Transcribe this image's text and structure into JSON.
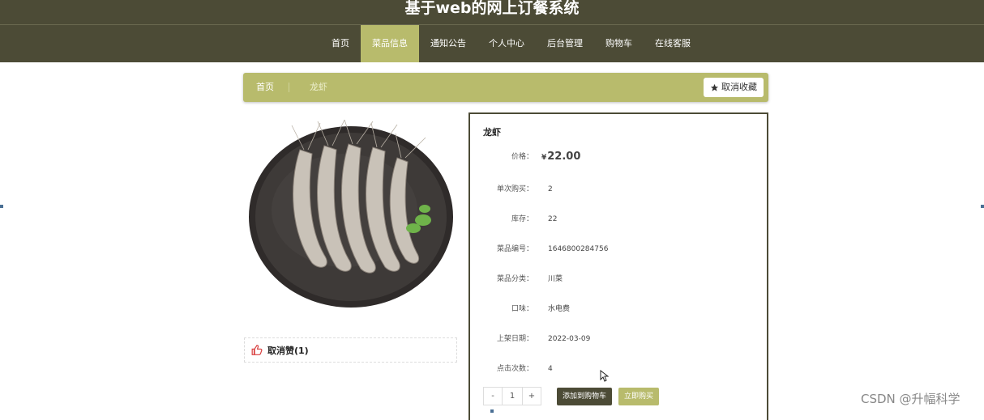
{
  "header": {
    "title": "基于web的网上订餐系统"
  },
  "nav": {
    "items": [
      {
        "label": "首页"
      },
      {
        "label": "菜品信息",
        "active": true
      },
      {
        "label": "通知公告"
      },
      {
        "label": "个人中心"
      },
      {
        "label": "后台管理"
      },
      {
        "label": "购物车"
      },
      {
        "label": "在线客服"
      }
    ]
  },
  "breadcrumb": {
    "home": "首页",
    "current": "龙虾"
  },
  "favorite_button": "取消收藏",
  "like": {
    "label": "取消赞(1)"
  },
  "product": {
    "name": "龙虾",
    "price_label": "价格：",
    "price_symbol": "¥",
    "price": "22.00",
    "rows": [
      {
        "label": "单次购买：",
        "value": "2"
      },
      {
        "label": "库存：",
        "value": "22"
      },
      {
        "label": "菜品编号：",
        "value": "1646800284756"
      },
      {
        "label": "菜品分类：",
        "value": "川菜"
      },
      {
        "label": "口味：",
        "value": "水电费"
      },
      {
        "label": "上架日期：",
        "value": "2022-03-09"
      },
      {
        "label": "点击次数：",
        "value": "4"
      }
    ]
  },
  "quantity": {
    "minus": "-",
    "value": "1",
    "plus": "+"
  },
  "actions": {
    "add_to_cart": "添加到购物车",
    "buy_now": "立即购买"
  },
  "watermark": "CSDN @升幅科学",
  "colors": {
    "header_bg": "#4c4b36",
    "accent": "#b8bb6c"
  },
  "icons": {
    "favorite": "star-icon",
    "like": "thumbs-up-icon",
    "cursor": "mouse-pointer-icon"
  }
}
